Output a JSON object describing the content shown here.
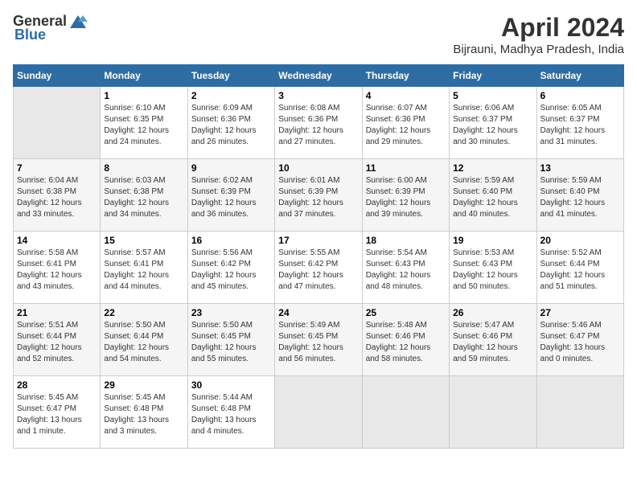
{
  "header": {
    "logo_general": "General",
    "logo_blue": "Blue",
    "month_title": "April 2024",
    "location": "Bijrauni, Madhya Pradesh, India"
  },
  "calendar": {
    "days_of_week": [
      "Sunday",
      "Monday",
      "Tuesday",
      "Wednesday",
      "Thursday",
      "Friday",
      "Saturday"
    ],
    "weeks": [
      [
        {
          "day": "",
          "info": ""
        },
        {
          "day": "1",
          "info": "Sunrise: 6:10 AM\nSunset: 6:35 PM\nDaylight: 12 hours\nand 24 minutes."
        },
        {
          "day": "2",
          "info": "Sunrise: 6:09 AM\nSunset: 6:36 PM\nDaylight: 12 hours\nand 26 minutes."
        },
        {
          "day": "3",
          "info": "Sunrise: 6:08 AM\nSunset: 6:36 PM\nDaylight: 12 hours\nand 27 minutes."
        },
        {
          "day": "4",
          "info": "Sunrise: 6:07 AM\nSunset: 6:36 PM\nDaylight: 12 hours\nand 29 minutes."
        },
        {
          "day": "5",
          "info": "Sunrise: 6:06 AM\nSunset: 6:37 PM\nDaylight: 12 hours\nand 30 minutes."
        },
        {
          "day": "6",
          "info": "Sunrise: 6:05 AM\nSunset: 6:37 PM\nDaylight: 12 hours\nand 31 minutes."
        }
      ],
      [
        {
          "day": "7",
          "info": "Sunrise: 6:04 AM\nSunset: 6:38 PM\nDaylight: 12 hours\nand 33 minutes."
        },
        {
          "day": "8",
          "info": "Sunrise: 6:03 AM\nSunset: 6:38 PM\nDaylight: 12 hours\nand 34 minutes."
        },
        {
          "day": "9",
          "info": "Sunrise: 6:02 AM\nSunset: 6:39 PM\nDaylight: 12 hours\nand 36 minutes."
        },
        {
          "day": "10",
          "info": "Sunrise: 6:01 AM\nSunset: 6:39 PM\nDaylight: 12 hours\nand 37 minutes."
        },
        {
          "day": "11",
          "info": "Sunrise: 6:00 AM\nSunset: 6:39 PM\nDaylight: 12 hours\nand 39 minutes."
        },
        {
          "day": "12",
          "info": "Sunrise: 5:59 AM\nSunset: 6:40 PM\nDaylight: 12 hours\nand 40 minutes."
        },
        {
          "day": "13",
          "info": "Sunrise: 5:59 AM\nSunset: 6:40 PM\nDaylight: 12 hours\nand 41 minutes."
        }
      ],
      [
        {
          "day": "14",
          "info": "Sunrise: 5:58 AM\nSunset: 6:41 PM\nDaylight: 12 hours\nand 43 minutes."
        },
        {
          "day": "15",
          "info": "Sunrise: 5:57 AM\nSunset: 6:41 PM\nDaylight: 12 hours\nand 44 minutes."
        },
        {
          "day": "16",
          "info": "Sunrise: 5:56 AM\nSunset: 6:42 PM\nDaylight: 12 hours\nand 45 minutes."
        },
        {
          "day": "17",
          "info": "Sunrise: 5:55 AM\nSunset: 6:42 PM\nDaylight: 12 hours\nand 47 minutes."
        },
        {
          "day": "18",
          "info": "Sunrise: 5:54 AM\nSunset: 6:43 PM\nDaylight: 12 hours\nand 48 minutes."
        },
        {
          "day": "19",
          "info": "Sunrise: 5:53 AM\nSunset: 6:43 PM\nDaylight: 12 hours\nand 50 minutes."
        },
        {
          "day": "20",
          "info": "Sunrise: 5:52 AM\nSunset: 6:44 PM\nDaylight: 12 hours\nand 51 minutes."
        }
      ],
      [
        {
          "day": "21",
          "info": "Sunrise: 5:51 AM\nSunset: 6:44 PM\nDaylight: 12 hours\nand 52 minutes."
        },
        {
          "day": "22",
          "info": "Sunrise: 5:50 AM\nSunset: 6:44 PM\nDaylight: 12 hours\nand 54 minutes."
        },
        {
          "day": "23",
          "info": "Sunrise: 5:50 AM\nSunset: 6:45 PM\nDaylight: 12 hours\nand 55 minutes."
        },
        {
          "day": "24",
          "info": "Sunrise: 5:49 AM\nSunset: 6:45 PM\nDaylight: 12 hours\nand 56 minutes."
        },
        {
          "day": "25",
          "info": "Sunrise: 5:48 AM\nSunset: 6:46 PM\nDaylight: 12 hours\nand 58 minutes."
        },
        {
          "day": "26",
          "info": "Sunrise: 5:47 AM\nSunset: 6:46 PM\nDaylight: 12 hours\nand 59 minutes."
        },
        {
          "day": "27",
          "info": "Sunrise: 5:46 AM\nSunset: 6:47 PM\nDaylight: 13 hours\nand 0 minutes."
        }
      ],
      [
        {
          "day": "28",
          "info": "Sunrise: 5:45 AM\nSunset: 6:47 PM\nDaylight: 13 hours\nand 1 minute."
        },
        {
          "day": "29",
          "info": "Sunrise: 5:45 AM\nSunset: 6:48 PM\nDaylight: 13 hours\nand 3 minutes."
        },
        {
          "day": "30",
          "info": "Sunrise: 5:44 AM\nSunset: 6:48 PM\nDaylight: 13 hours\nand 4 minutes."
        },
        {
          "day": "",
          "info": ""
        },
        {
          "day": "",
          "info": ""
        },
        {
          "day": "",
          "info": ""
        },
        {
          "day": "",
          "info": ""
        }
      ]
    ]
  }
}
